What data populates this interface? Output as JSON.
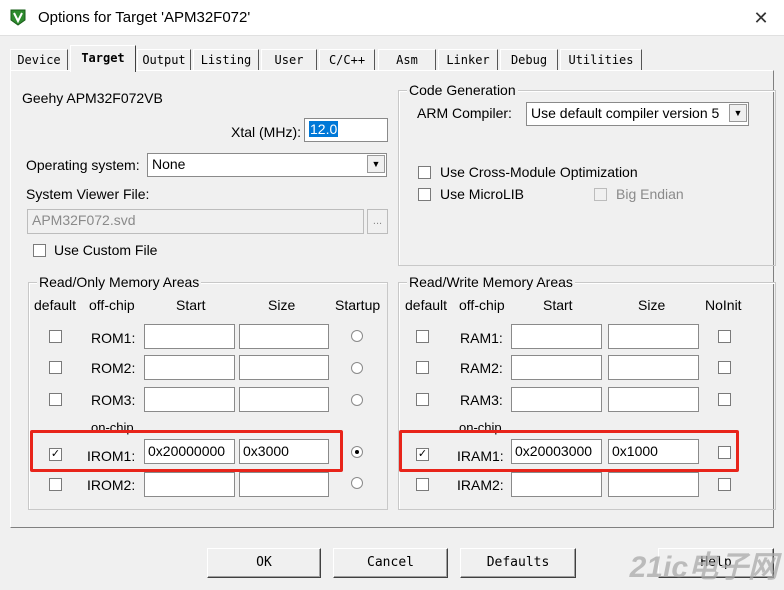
{
  "window": {
    "title": "Options for Target 'APM32F072'",
    "close": "✕"
  },
  "tabs": [
    {
      "label": "Device"
    },
    {
      "label": "Target"
    },
    {
      "label": "Output"
    },
    {
      "label": "Listing"
    },
    {
      "label": "User"
    },
    {
      "label": "C/C++"
    },
    {
      "label": "Asm"
    },
    {
      "label": "Linker"
    },
    {
      "label": "Debug"
    },
    {
      "label": "Utilities"
    }
  ],
  "device_name": "Geehy APM32F072VB",
  "xtal": {
    "label": "Xtal (MHz):",
    "value": "12.0"
  },
  "os": {
    "label": "Operating system:",
    "value": "None"
  },
  "svd": {
    "label": "System Viewer File:",
    "value": "APM32F072.svd",
    "browse": "..."
  },
  "custom_file": {
    "label": "Use Custom File",
    "checked": false
  },
  "codegen": {
    "title": "Code Generation",
    "compiler_label": "ARM Compiler:",
    "compiler_value": "Use default compiler version 5",
    "cross_module": "Use Cross-Module Optimization",
    "microlib": "Use MicroLIB",
    "big_endian": "Big Endian"
  },
  "rom": {
    "title": "Read/Only Memory Areas",
    "headers": {
      "default": "default",
      "offchip": "off-chip",
      "start": "Start",
      "size": "Size",
      "startup": "Startup"
    },
    "onchip": "on-chip",
    "rows": [
      {
        "label": "ROM1:",
        "default": false,
        "start": "",
        "size": "",
        "startup": false
      },
      {
        "label": "ROM2:",
        "default": false,
        "start": "",
        "size": "",
        "startup": false
      },
      {
        "label": "ROM3:",
        "default": false,
        "start": "",
        "size": "",
        "startup": false
      },
      {
        "label": "IROM1:",
        "default": true,
        "start": "0x20000000",
        "size": "0x3000",
        "startup": true
      },
      {
        "label": "IROM2:",
        "default": false,
        "start": "",
        "size": "",
        "startup": false
      }
    ]
  },
  "ram": {
    "title": "Read/Write Memory Areas",
    "headers": {
      "default": "default",
      "offchip": "off-chip",
      "start": "Start",
      "size": "Size",
      "noinit": "NoInit"
    },
    "onchip": "on-chip",
    "rows": [
      {
        "label": "RAM1:",
        "default": false,
        "start": "",
        "size": "",
        "noinit": false
      },
      {
        "label": "RAM2:",
        "default": false,
        "start": "",
        "size": "",
        "noinit": false
      },
      {
        "label": "RAM3:",
        "default": false,
        "start": "",
        "size": "",
        "noinit": false
      },
      {
        "label": "IRAM1:",
        "default": true,
        "start": "0x20003000",
        "size": "0x1000",
        "noinit": false
      },
      {
        "label": "IRAM2:",
        "default": false,
        "start": "",
        "size": "",
        "noinit": false
      }
    ]
  },
  "buttons": {
    "ok": "OK",
    "cancel": "Cancel",
    "defaults": "Defaults",
    "help": "Help"
  },
  "watermark": "21ic电子网",
  "colors": {
    "highlight": "#e8241a",
    "selection": "#0078d7"
  }
}
